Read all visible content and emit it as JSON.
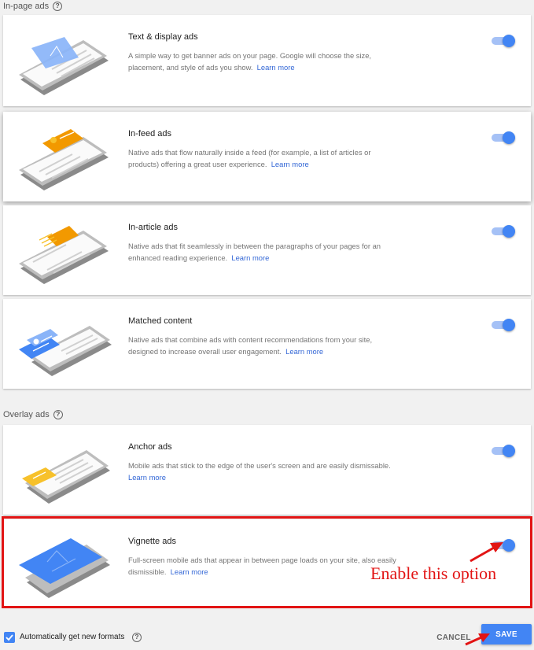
{
  "sections": {
    "in_page": "In-page ads",
    "overlay": "Overlay ads"
  },
  "cards": [
    {
      "title": "Text & display ads",
      "desc": "A simple way to get banner ads on your page. Google will choose the size, placement, and style of ads you show.",
      "link": "Learn more",
      "enabled": true,
      "illustration": "banner-phone-illustration"
    },
    {
      "title": "In-feed ads",
      "desc": "Native ads that flow naturally inside a feed (for example, a list of articles or products) offering a great user experience.",
      "link": "Learn more",
      "enabled": true,
      "illustration": "feed-phone-illustration"
    },
    {
      "title": "In-article ads",
      "desc": "Native ads that fit seamlessly in between the paragraphs of your pages for an enhanced reading experience.",
      "link": "Learn more",
      "enabled": true,
      "illustration": "article-phone-illustration"
    },
    {
      "title": "Matched content",
      "desc": "Native ads that combine ads with content recommendations from your site, designed to increase overall user engagement.",
      "link": "Learn more",
      "enabled": true,
      "illustration": "matched-content-phone-illustration"
    },
    {
      "title": "Anchor ads",
      "desc": "Mobile ads that stick to the edge of the user's screen and are easily dismissable.",
      "link": "Learn more",
      "enabled": true,
      "illustration": "anchor-phone-illustration"
    },
    {
      "title": "Vignette ads",
      "desc": "Full-screen mobile ads that appear in between page loads on your site, also easily dismissible.",
      "link": "Learn more",
      "enabled": true,
      "illustration": "vignette-phone-illustration"
    }
  ],
  "annotation": "Enable this option",
  "footer": {
    "auto_formats_label": "Automatically get new formats",
    "auto_formats_checked": true,
    "cancel_label": "CANCEL",
    "save_label": "SAVE"
  },
  "colors": {
    "accent": "#4285f4",
    "link": "#3367d6",
    "annotation_red": "#e21414",
    "ad_orange": "#f29900",
    "ad_yellow": "#f7c12b",
    "ad_lightblue": "#8ab4f8"
  },
  "icons": [
    "help-icon",
    "toggle-switch",
    "checkbox-checked-icon",
    "red-arrow"
  ]
}
